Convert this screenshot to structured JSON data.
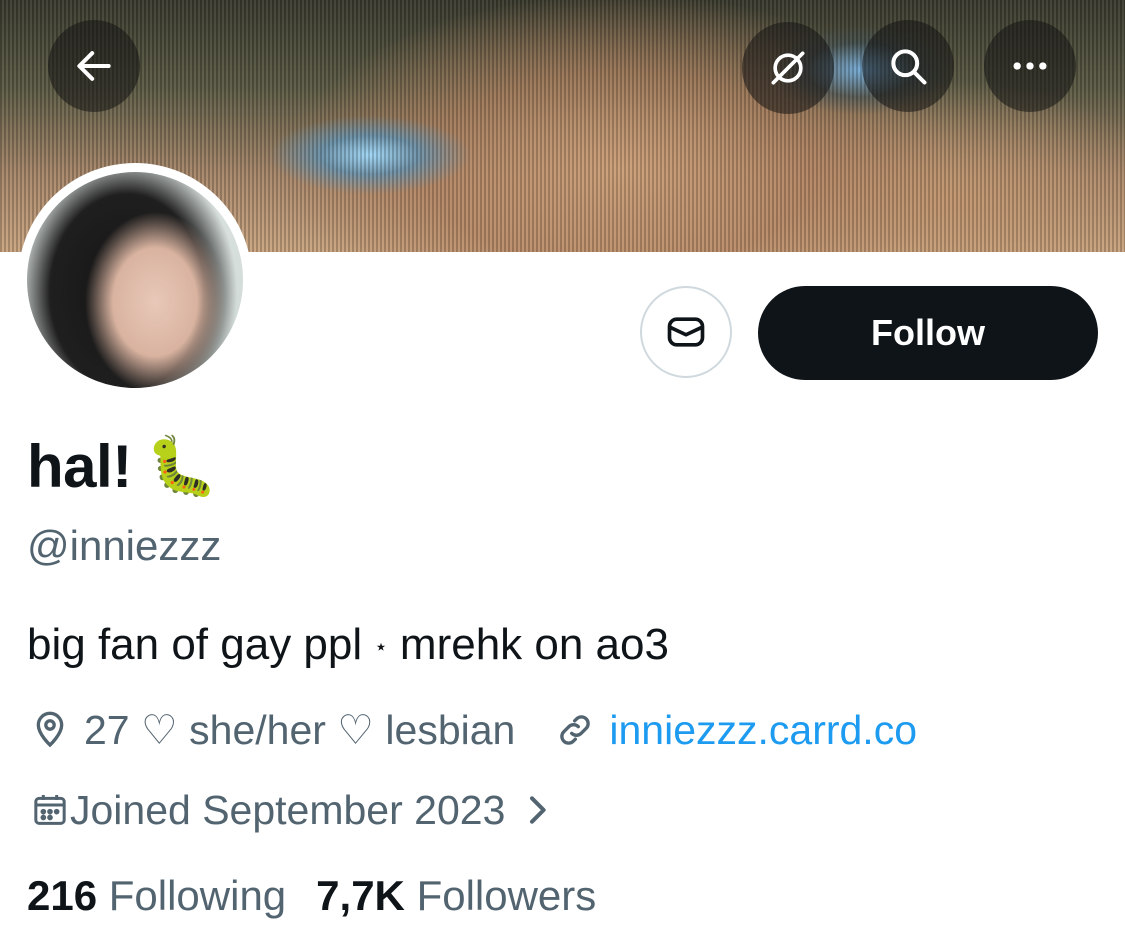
{
  "header": {
    "back_icon": "arrow-left-icon",
    "translate_icon": "translate-icon",
    "search_icon": "search-icon",
    "more_icon": "more-icon"
  },
  "profile": {
    "display_name": "hal!",
    "emoji": "🐛",
    "handle": "@inniezzz",
    "bio_part1": "big fan of gay ppl",
    "bio_separator": "⋆",
    "bio_part2": "mrehk on ao3",
    "location": "27 ♡ she/her ♡ lesbian",
    "website": "inniezzz.carrd.co",
    "joined": "Joined September 2023",
    "following_count": "216",
    "following_label": "Following",
    "followers_count": "7,7K",
    "followers_label": "Followers"
  },
  "actions": {
    "message_icon": "envelope-icon",
    "follow_label": "Follow"
  },
  "colors": {
    "text_primary": "#0f1419",
    "text_secondary": "#536471",
    "link": "#1d9bf0",
    "follow_bg": "#0f1419"
  }
}
